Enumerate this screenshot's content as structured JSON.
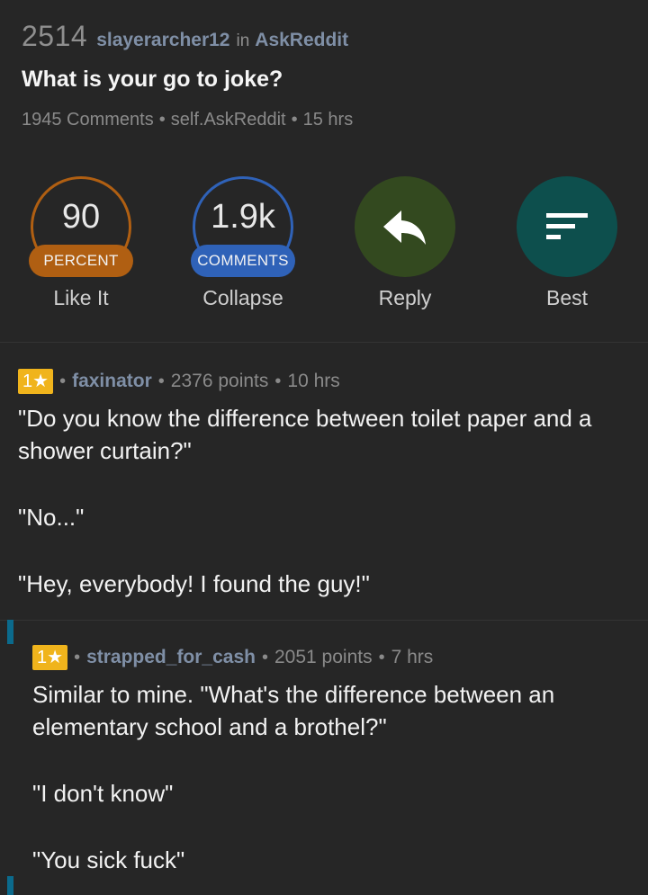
{
  "post": {
    "score": "2514",
    "author": "slayerarcher12",
    "in_word": "in",
    "subreddit": "AskReddit",
    "title": "What is your go to joke?",
    "comments_count": "1945 Comments",
    "domain": "self.AskReddit",
    "age": "15 hrs"
  },
  "actions": {
    "like": {
      "value": "90",
      "pill": "PERCENT",
      "label": "Like It",
      "color": "#b05f12"
    },
    "collapse": {
      "value": "1.9k",
      "pill": "COMMENTS",
      "label": "Collapse",
      "color": "#2f62b8"
    },
    "reply": {
      "icon": "reply-arrow-icon",
      "label": "Reply",
      "color": "#33491f"
    },
    "best": {
      "icon": "sort-lines-icon",
      "label": "Best",
      "color": "#0d4f4d"
    }
  },
  "comments": [
    {
      "badge": "1★",
      "author": "faxinator",
      "points": "2376 points",
      "age": "10 hrs",
      "paragraphs": [
        "\"Do you know the difference between toilet paper and a shower curtain?\"",
        "\"No...\"",
        "\"Hey, everybody! I found the guy!\""
      ]
    },
    {
      "badge": "1★",
      "author": "strapped_for_cash",
      "points": "2051 points",
      "age": "7 hrs",
      "paragraphs": [
        "Similar to mine. \"What's the difference between an elementary school and a brothel?\"",
        "\"I don't know\"",
        "\"You sick fuck\""
      ]
    }
  ],
  "colors": {
    "background": "#262626",
    "username": "#7f8fa6",
    "badge": "#f0b41c",
    "thread_bar": "#0b6a8c"
  }
}
